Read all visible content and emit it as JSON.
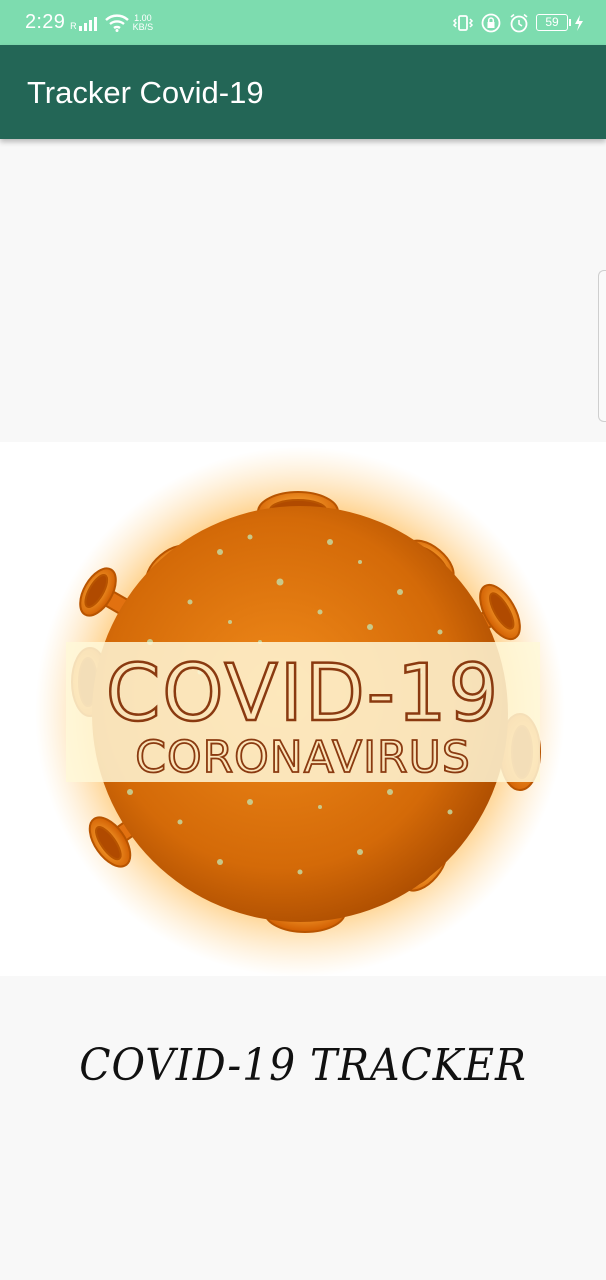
{
  "status_bar": {
    "time": "2:29",
    "carrier_indicator": "R",
    "net_speed_value": "1.00",
    "net_speed_unit": "KB/S",
    "battery_level": "59",
    "icons": [
      "signal-icon",
      "wifi-icon",
      "vibrate-icon",
      "lock-icon",
      "alarm-icon",
      "battery-icon",
      "charging-icon"
    ]
  },
  "app_bar": {
    "title": "Tracker Covid-19",
    "color": "#236656"
  },
  "hero": {
    "headline": "COVID-19",
    "subline": "CORONAVIRUS"
  },
  "footer": {
    "title": "COVID-19 TRACKER"
  },
  "colors": {
    "status_bar": "#7ddcaf",
    "virus_orange": "#e07a10",
    "text_brown": "#8a3a10"
  }
}
